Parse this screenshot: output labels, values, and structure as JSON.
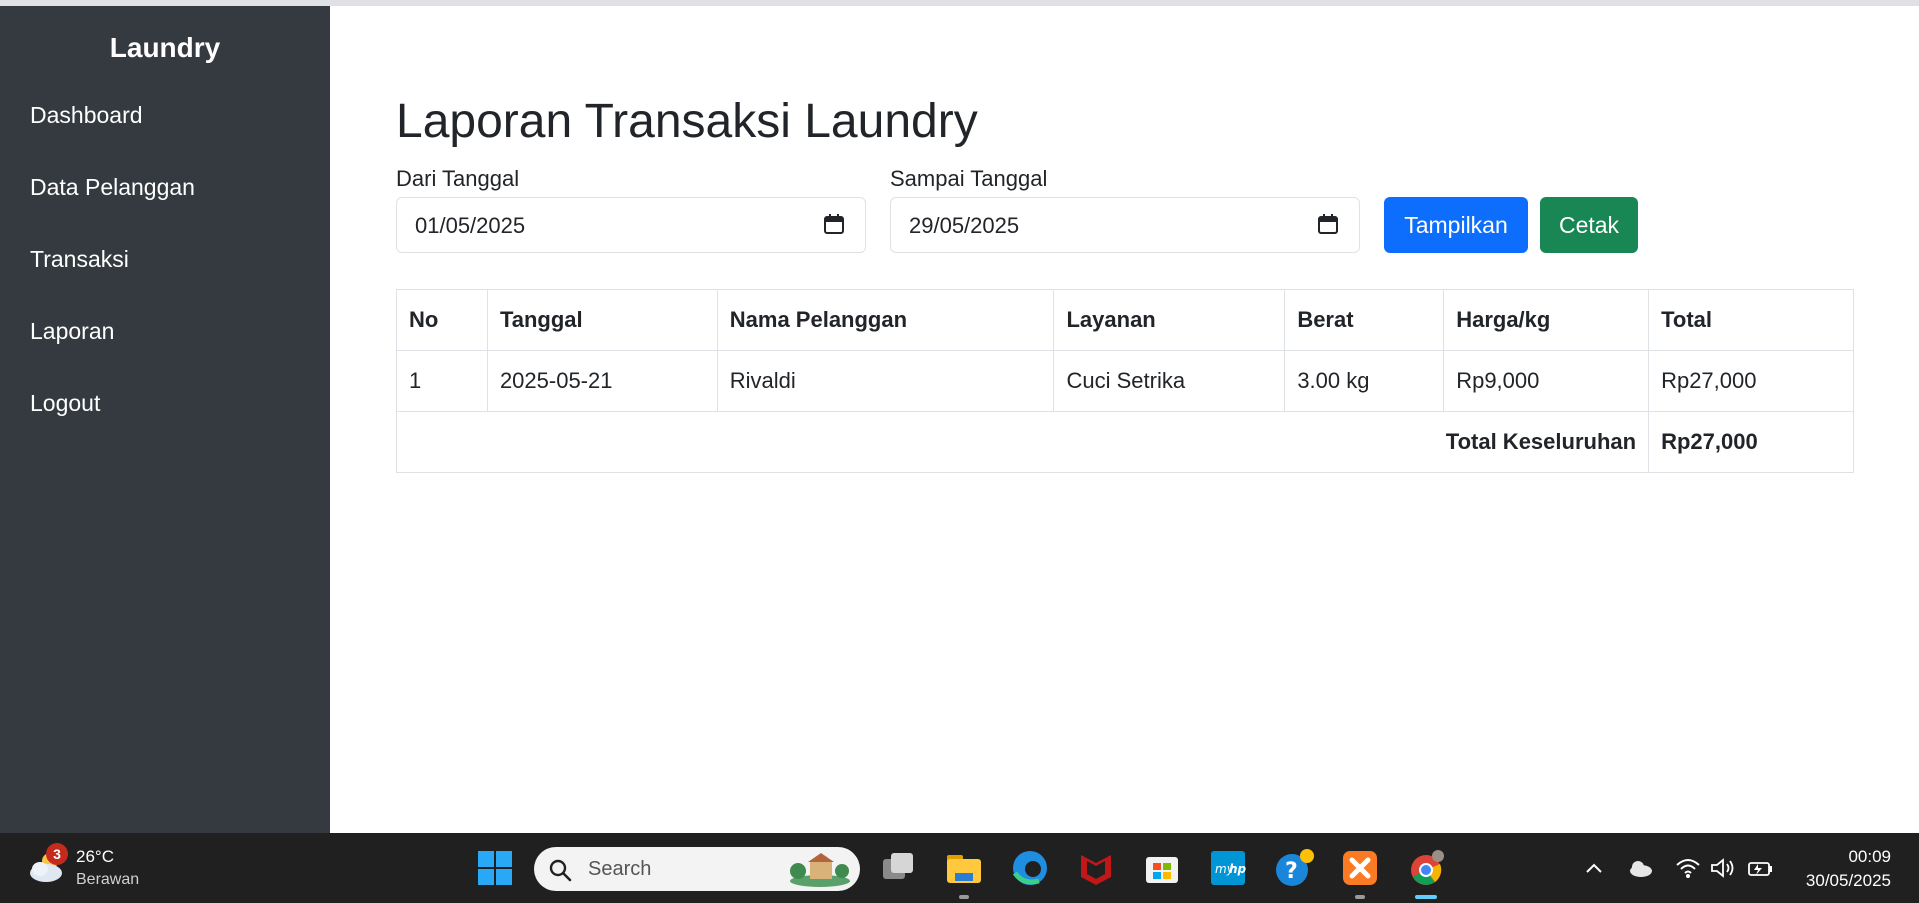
{
  "sidebar": {
    "brand": "Laundry",
    "items": [
      {
        "label": "Dashboard"
      },
      {
        "label": "Data Pelanggan"
      },
      {
        "label": "Transaksi"
      },
      {
        "label": "Laporan"
      },
      {
        "label": "Logout"
      }
    ]
  },
  "main": {
    "title": "Laporan Transaksi Laundry",
    "filter": {
      "from_label": "Dari Tanggal",
      "from_value": "01/05/2025",
      "to_label": "Sampai Tanggal",
      "to_value": "29/05/2025",
      "show_button": "Tampilkan",
      "print_button": "Cetak"
    },
    "table": {
      "headers": [
        "No",
        "Tanggal",
        "Nama Pelanggan",
        "Layanan",
        "Berat",
        "Harga/kg",
        "Total"
      ],
      "rows": [
        [
          "1",
          "2025-05-21",
          "Rivaldi",
          "Cuci Setrika",
          "3.00 kg",
          "Rp9,000",
          "Rp27,000"
        ]
      ],
      "total_label": "Total Keseluruhan",
      "total_value": "Rp27,000"
    }
  },
  "taskbar": {
    "weather": {
      "badge": "3",
      "temp": "26°C",
      "condition": "Berawan"
    },
    "search_placeholder": "Search",
    "clock": {
      "time": "00:09",
      "date": "30/05/2025"
    }
  },
  "colors": {
    "sidebar_bg": "#343a40",
    "primary": "#0d6efd",
    "success": "#198754",
    "taskbar_bg": "#202020"
  }
}
